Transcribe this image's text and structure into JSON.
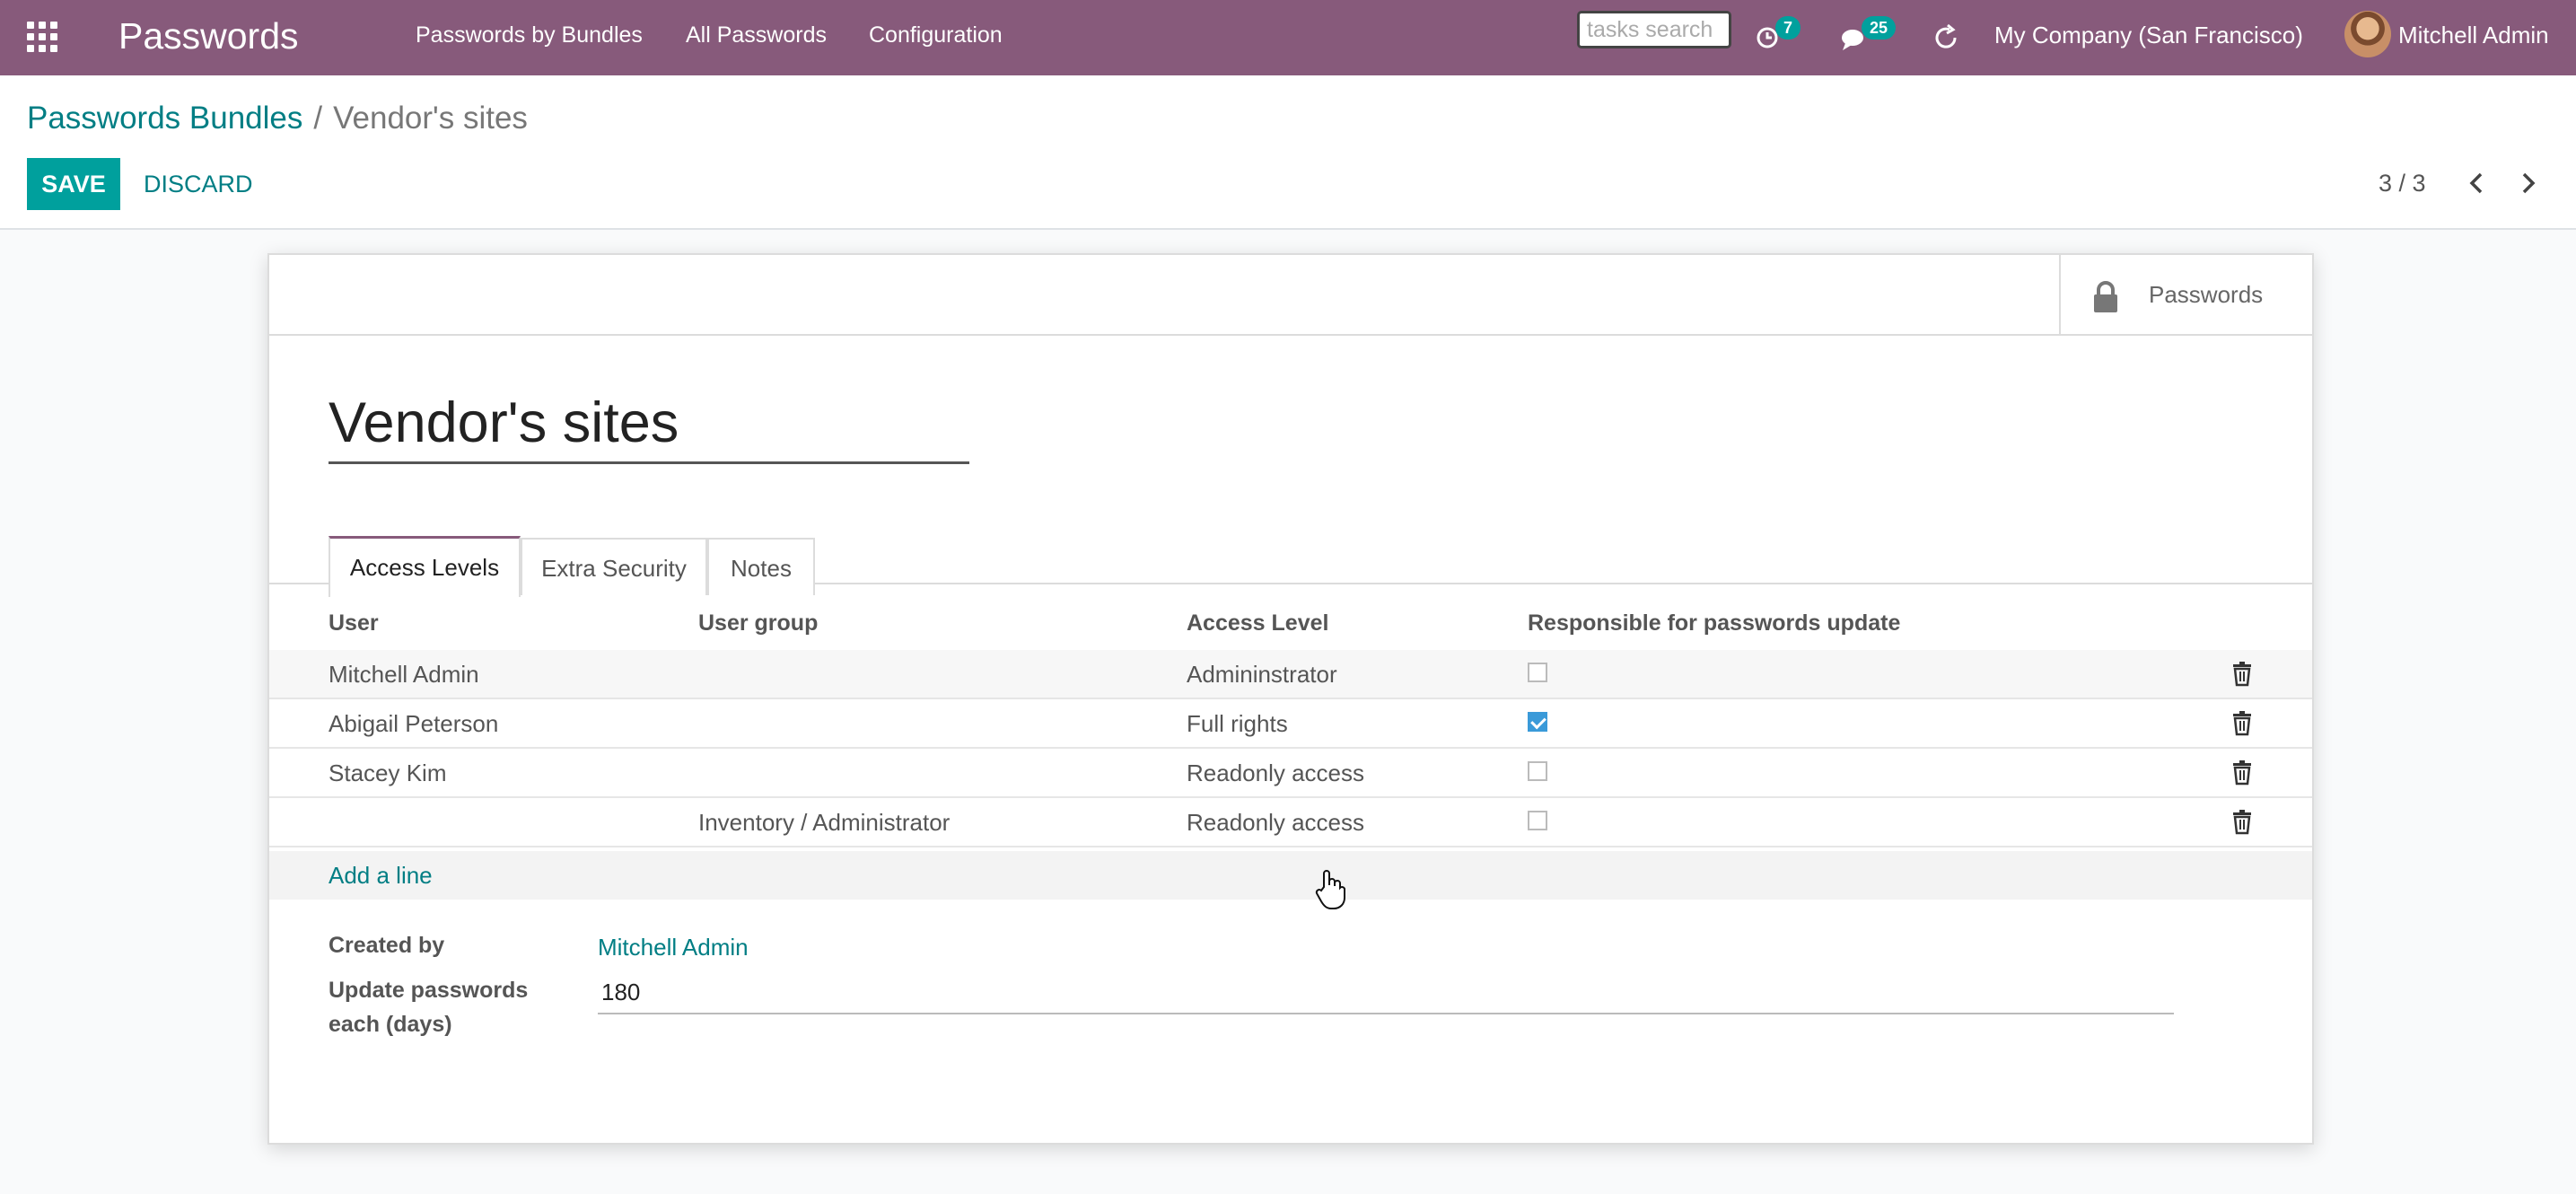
{
  "navbar": {
    "app_title": "Passwords",
    "menu": [
      "Passwords by Bundles",
      "All Passwords",
      "Configuration"
    ],
    "search_placeholder": "tasks search",
    "activity_count": "7",
    "messages_count": "25",
    "company": "My Company (San Francisco)",
    "user": "Mitchell Admin",
    "icons": [
      "apps-grid-icon",
      "clock-icon",
      "chat-icon",
      "refresh-icon"
    ]
  },
  "breadcrumb": {
    "parent": "Passwords Bundles",
    "separator": "/",
    "current": "Vendor's sites"
  },
  "toolbar": {
    "save_label": "SAVE",
    "discard_label": "DISCARD",
    "pager": "3 / 3"
  },
  "form": {
    "smart_button_label": "Passwords",
    "title": "Vendor's sites",
    "tabs": [
      "Access Levels",
      "Extra Security",
      "Notes"
    ],
    "active_tab": "Access Levels",
    "columns": [
      "User",
      "User group",
      "Access Level",
      "Responsible for passwords update"
    ],
    "rows": [
      {
        "user": "Mitchell Admin",
        "group": "",
        "access": "Admininstrator",
        "responsible": false
      },
      {
        "user": "Abigail Peterson",
        "group": "",
        "access": "Full rights",
        "responsible": true
      },
      {
        "user": "Stacey Kim",
        "group": "",
        "access": "Readonly access",
        "responsible": false
      },
      {
        "user": "",
        "group": "Inventory / Administrator",
        "access": "Readonly access",
        "responsible": false
      }
    ],
    "add_line_label": "Add a line",
    "created_by_label": "Created by",
    "created_by_value": "Mitchell Admin",
    "update_label_line1": "Update passwords",
    "update_label_line2": "each (days)",
    "update_value": "180"
  },
  "colors": {
    "navbar": "#875a7b",
    "primary": "#00a09d",
    "link": "#017e84",
    "checkbox_checked": "#3a9ad9"
  }
}
